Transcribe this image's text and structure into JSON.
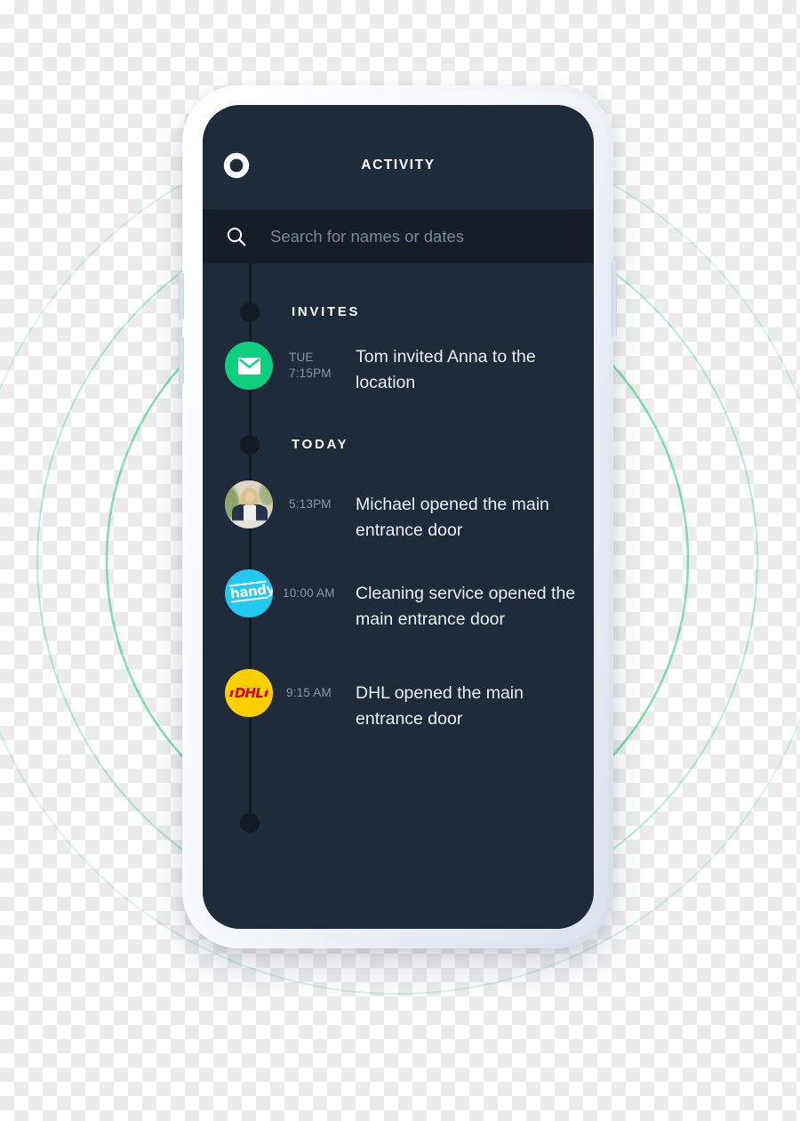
{
  "device": {
    "type": "smartphone-mockup",
    "frame_color": "#e3e8f1",
    "screen_bg": "#1f2b3a"
  },
  "background": {
    "kind": "transparency-checkerboard",
    "ring_color": "#3fc98c",
    "ring_count": 3
  },
  "header": {
    "title": "ACTIVITY",
    "logo_icon": "circle-split-logo-icon",
    "bg": "#1f2b3a"
  },
  "search": {
    "icon": "search-icon",
    "placeholder": "Search for names or dates",
    "value": "",
    "bg": "#151e27"
  },
  "feed": {
    "accent_green": "#0fcf80",
    "timeline_color": "#121a24",
    "sections": [
      {
        "id": "invites",
        "label": "INVITES",
        "items": [
          {
            "badge": "mail-envelope-icon",
            "badge_color": "#0fcf80",
            "day": "TUE",
            "time": "7:15PM",
            "text": "Tom invited Anna to the location"
          }
        ]
      },
      {
        "id": "today",
        "label": "TODAY",
        "items": [
          {
            "badge": "user-avatar-photo",
            "badge_color": "#c6c8ae",
            "day": "",
            "time": "5:13PM",
            "text": "Michael opened the main entrance door"
          },
          {
            "badge": "handy-logo-icon",
            "badge_color": "#22c8ee",
            "day": "",
            "time": "10:00 AM",
            "text": "Cleaning service opened the main entrance door"
          },
          {
            "badge": "dhl-logo-icon",
            "badge_color": "#fccf00",
            "day": "",
            "time": "9:15 AM",
            "text": "DHL opened the main entrance door"
          }
        ]
      }
    ]
  }
}
